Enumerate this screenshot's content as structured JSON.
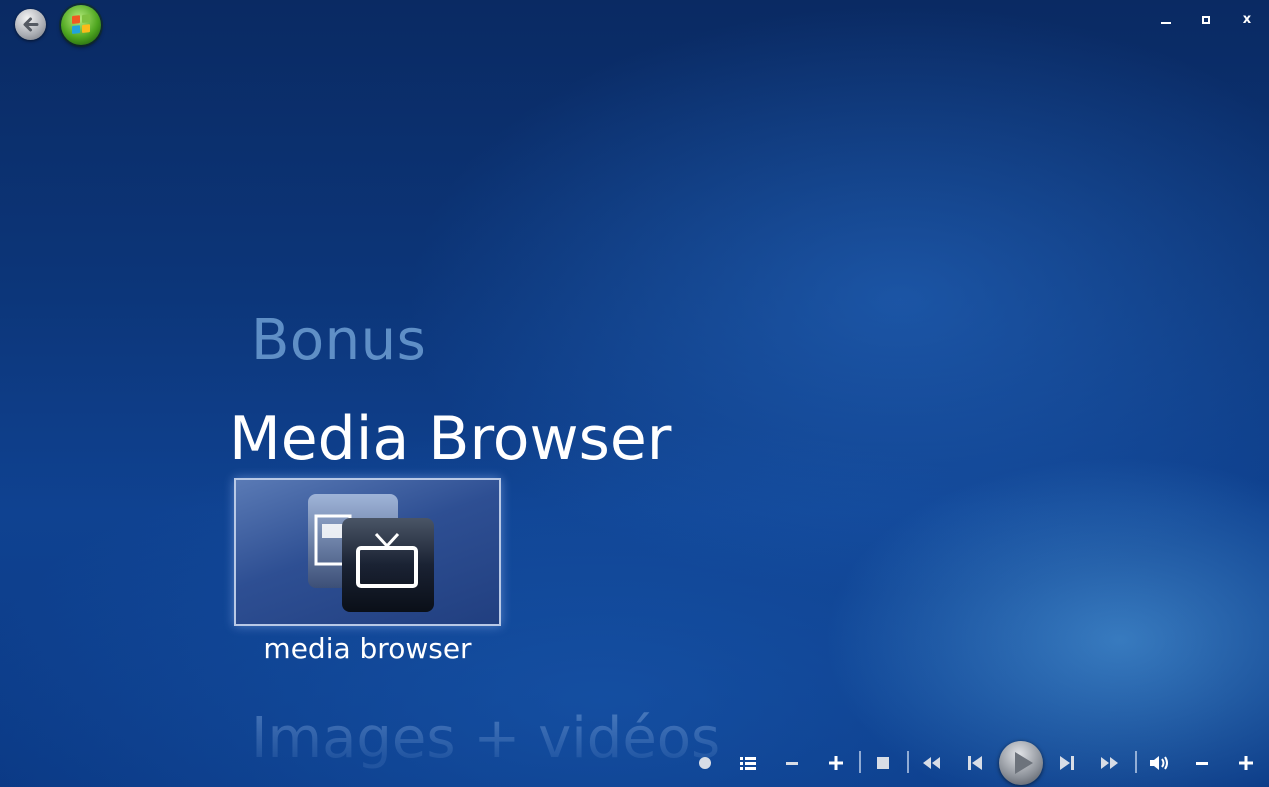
{
  "menu": {
    "previous": "Bonus",
    "current": "Media Browser",
    "next": "Images + vidéos"
  },
  "tile": {
    "label": "media browser",
    "icon": "media-browser-icon"
  },
  "window_controls": {
    "close_label": "x"
  },
  "icons": {
    "back": "back-arrow-icon",
    "start": "windows-media-center-orb-icon",
    "record": "record-icon",
    "guide": "list-icon",
    "channel_down": "minus-icon",
    "channel_up": "plus-icon",
    "stop": "stop-icon",
    "rewind": "rewind-icon",
    "previous": "skip-previous-icon",
    "play": "play-icon",
    "next": "skip-next-icon",
    "fast_forward": "fast-forward-icon",
    "mute": "volume-icon",
    "volume_down": "minus-icon",
    "volume_up": "plus-icon"
  }
}
